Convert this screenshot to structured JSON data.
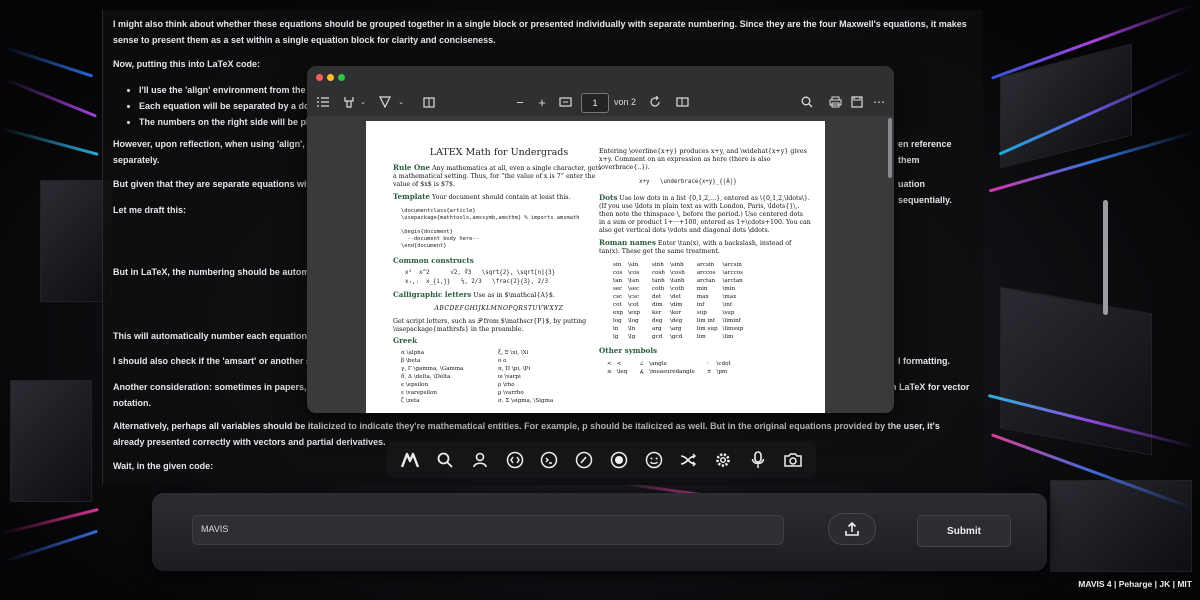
{
  "chat": {
    "paragraphs": [
      "I might also think about whether these equations should be grouped together in a single block or presented individually with separate numbering. Since they are the four Maxwell's equations, it makes sense to present them as a set within a single equation block for clarity and conciseness.",
      "Now, putting this into LaTeX code:",
      "However, upon reflection, when using 'align', e",
      "en reference them",
      "separately.",
      "But given that they are separate equations wit",
      "uation sequentially.",
      "Let me draft this:",
      "But in LaTeX, the numbering should be automa",
      "This will automatically number each equation.",
      "I should also check if the 'amsart' or another su",
      "l formatting.",
      "Another consideration: sometimes in papers, v",
      "on in LaTeX for vector",
      "notation.",
      "Alternatively, perhaps all variables should be italicized to indicate they're mathematical entities. For example, p should be italicized as well. But in the original equations provided by the user, it's already presented correctly with vectors and partial derivatives.",
      "Wait, in the given code:"
    ],
    "bullets": [
      "I'll use the 'align' environment from the a",
      "Each equation will be separated by a dou",
      "The numbers on the right side will be pla"
    ]
  },
  "pdf_viewer": {
    "page_current": "1",
    "page_total": "von 2",
    "traffic_colors": [
      "#ff5f57",
      "#febc2e",
      "#28c840"
    ]
  },
  "pdf_page": {
    "title": "LATEX Math for Undergrads",
    "rule_one_h": "Rule One",
    "rule_one_t": "Any mathematics at all, even a single character, gets a mathematical setting. Thus, for “the value of x is 7” enter the value of $x$ is $7$.",
    "template_h": "Template",
    "template_t": "Your document should contain at least this.",
    "template_code": "\\documentclass{article}\n\\usepackage{mathtools,amssymb,amsthm} % imports amsmath\n\n\\begin{document}\n  --document body here--\n\\end{document}",
    "common_h": "Common constructs",
    "common_code": "x²  x^2      √2, ∛3   \\sqrt{2}, \\sqrt[n]{3}\nxᵢ,ⱼ  x_{i,j}   ⅔, 2/3   \\frac{2}{3}, 2/3",
    "calli_h": "Calligraphic letters",
    "calli_t": "Use as in $\\mathcal{A}$.",
    "calli_alpha": "ABCDEFGHIJKLMNOPQRSTUVWXYZ",
    "script_t": "Get script letters, such as 𝒫 from $\\mathscr{P}$, by putting \\usepackage{mathrsfs} in the preamble.",
    "greek_h": "Greek",
    "greek_rows": [
      [
        "α  \\alpha",
        "ξ, Ξ  \\xi, \\Xi"
      ],
      [
        "β  \\beta",
        "o  o"
      ],
      [
        "γ, Γ  \\gamma, \\Gamma",
        "π, Π  \\pi, \\Pi"
      ],
      [
        "δ, Δ  \\delta, \\Delta",
        "ϖ  \\varpi"
      ],
      [
        "ϵ  \\epsilon",
        "ρ  \\rho"
      ],
      [
        "ε  \\varepsilon",
        "ϱ  \\varrho"
      ],
      [
        "ζ  \\zeta",
        "σ, Σ  \\sigma, \\Sigma"
      ]
    ],
    "right_intro": "Entering \\overline{x+y} produces x+y, and \\widehat{x+y} gives x+y. Comment on an expression as here (there is also \\overbrace{..}).",
    "underbrace": "x+y   \\underbrace{x+y}_{|A|}",
    "dots_h": "Dots",
    "dots_t": "Use low dots in a list {0,1,2,...}, entered as \\{0,1,2,\\ldots\\}. (If you use \\ldots in plain text as with London, Paris, \\ldots{}\\,. then note the thinspace \\, before the period.) Use centered dots in a sum or product 1+···+100, entered as 1+\\cdots+100. You can also get vertical dots \\vdots and diagonal dots \\ddots.",
    "roman_h": "Roman names",
    "roman_t": "Enter \\tan(x), with a backslash, instead of tan(x). These get the same treatment.",
    "roman_rows": [
      [
        "sin",
        "\\sin",
        "sinh",
        "\\sinh",
        "arcsin",
        "\\arcsin"
      ],
      [
        "cos",
        "\\cos",
        "cosh",
        "\\cosh",
        "arccos",
        "\\arccos"
      ],
      [
        "tan",
        "\\tan",
        "tanh",
        "\\tanh",
        "arctan",
        "\\arctan"
      ],
      [
        "sec",
        "\\sec",
        "coth",
        "\\coth",
        "min",
        "\\min"
      ],
      [
        "csc",
        "\\csc",
        "det",
        "\\det",
        "max",
        "\\max"
      ],
      [
        "cot",
        "\\cot",
        "dim",
        "\\dim",
        "inf",
        "\\inf"
      ],
      [
        "exp",
        "\\exp",
        "ker",
        "\\ker",
        "sup",
        "\\sup"
      ],
      [
        "log",
        "\\log",
        "deg",
        "\\deg",
        "lim inf",
        "\\liminf"
      ],
      [
        "ln",
        "\\ln",
        "arg",
        "\\arg",
        "lim sup",
        "\\limsup"
      ],
      [
        "lg",
        "\\lg",
        "gcd",
        "\\gcd",
        "lim",
        "\\lim"
      ]
    ],
    "other_h": "Other symbols",
    "other_rows": [
      [
        "<",
        "<",
        "∠",
        "\\angle",
        "·",
        "\\cdot"
      ],
      [
        "≤",
        "\\leq",
        "∡",
        "\\measuredangle",
        "±",
        "\\pm"
      ]
    ]
  },
  "dock": {
    "icons": [
      "mavis-logo-icon",
      "search-icon",
      "user-icon",
      "code-brackets-icon",
      "terminal-icon",
      "paperclip-icon",
      "target-icon",
      "face-icon",
      "shuffle-icon",
      "settings-gear-icon",
      "microphone-icon",
      "camera-icon"
    ]
  },
  "input": {
    "value": "MAVIS"
  },
  "submit_label": "Submit",
  "footer": "MAVIS 4 | Peharge | JK | MIT"
}
